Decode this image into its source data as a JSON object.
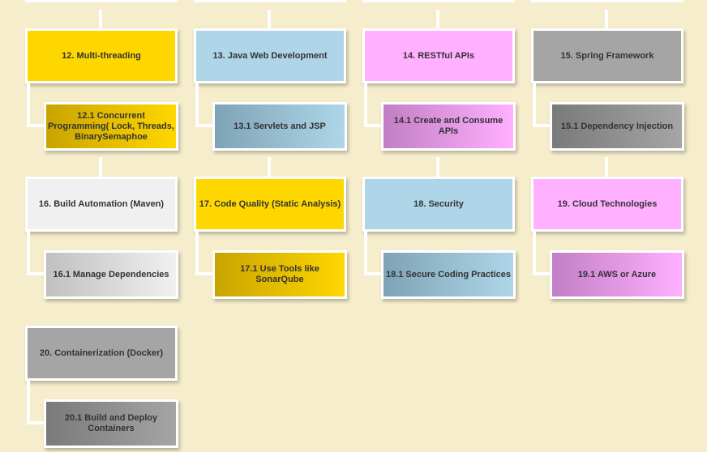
{
  "columns": [
    {
      "groups": [
        {
          "parent": {
            "label": "12. Multi-threading",
            "bg": "#ffd700"
          },
          "child": {
            "label": "12.1 Concurrent Programming( Lock, Threads, BinarySemaphoe",
            "bg": "linear-gradient(90deg,#c9a400 0%,#ffd700 100%)"
          }
        },
        {
          "parent": {
            "label": "16. Build Automation (Maven)",
            "bg": "#f0f0f0"
          },
          "child": {
            "label": "16.1 Manage Dependencies",
            "bg": "linear-gradient(90deg,#c0c0c0 0%,#f0f0f0 100%)"
          }
        },
        {
          "parent": {
            "label": "20. Containerization (Docker)",
            "bg": "#a5a5a5"
          },
          "child": {
            "label": "20.1 Build and Deploy Containers",
            "bg": "linear-gradient(90deg,#7a7a7a 0%,#a5a5a5 100%)"
          }
        }
      ]
    },
    {
      "groups": [
        {
          "parent": {
            "label": "13. Java Web Development",
            "bg": "#aed6e8"
          },
          "child": {
            "label": "13.1 Servlets and JSP",
            "bg": "linear-gradient(90deg,#7fa3b6 0%,#aed6e8 100%)"
          }
        },
        {
          "parent": {
            "label": "17. Code Quality (Static Analysis)",
            "bg": "#ffd700"
          },
          "child": {
            "label": "17.1 Use Tools like SonarQube",
            "bg": "linear-gradient(90deg,#c9a400 0%,#ffd700 100%)"
          }
        }
      ]
    },
    {
      "groups": [
        {
          "parent": {
            "label": "14. RESTful APIs",
            "bg": "#ffb0ff"
          },
          "child": {
            "label": "14.1 Create and Consume APIs",
            "bg": "linear-gradient(90deg,#c27fc5 0%,#ffb0ff 100%)"
          }
        },
        {
          "parent": {
            "label": "18. Security",
            "bg": "#aed6e8"
          },
          "child": {
            "label": "18.1 Secure Coding Practices",
            "bg": "linear-gradient(90deg,#7fa3b6 0%,#aed6e8 100%)"
          }
        }
      ]
    },
    {
      "groups": [
        {
          "parent": {
            "label": "15. Spring Framework",
            "bg": "#a5a5a5"
          },
          "child": {
            "label": "15.1 Dependency Injection",
            "bg": "linear-gradient(90deg,#7a7a7a 0%,#a5a5a5 100%)"
          }
        },
        {
          "parent": {
            "label": "19. Cloud Technologies",
            "bg": "#ffb0ff"
          },
          "child": {
            "label": "19.1 AWS or Azure",
            "bg": "linear-gradient(90deg,#c27fc5 0%,#ffb0ff 100%)"
          }
        }
      ]
    }
  ]
}
